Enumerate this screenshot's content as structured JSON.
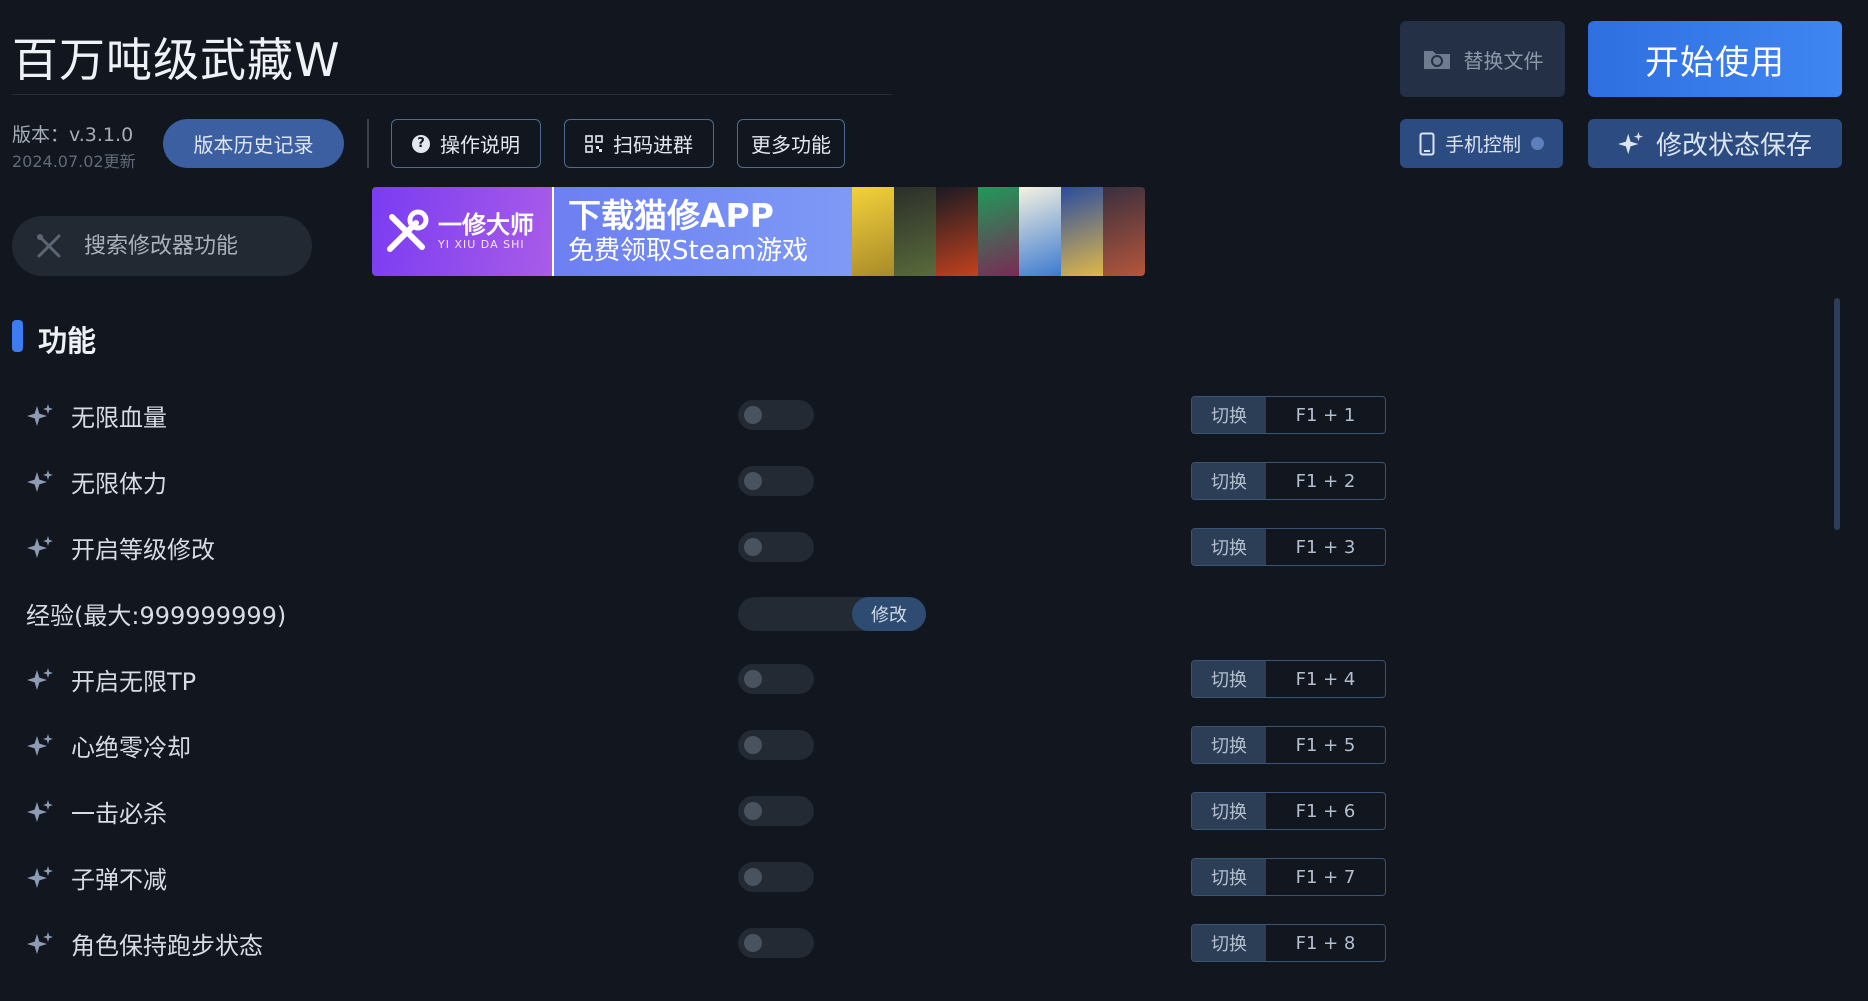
{
  "header": {
    "title": "百万吨级武藏W",
    "version": "版本：v.3.1.0",
    "version_date": "2024.07.02更新",
    "history_button": "版本历史记录",
    "help_button": "操作说明",
    "qr_button": "扫码进群",
    "more_button": "更多功能",
    "replace_file_button": "替换文件",
    "start_button": "开始使用",
    "phone_control_button": "手机控制",
    "save_state_button": "修改状态保存"
  },
  "search": {
    "placeholder": "搜索修改器功能"
  },
  "banner": {
    "brand_name": "一修大师",
    "brand_sub": "YI XIU DA SHI",
    "headline": "下载猫修APP",
    "subline": "免费领取Steam游戏"
  },
  "section": {
    "title": "功能"
  },
  "features": [
    {
      "label": "无限血量",
      "tag": "切换",
      "hotkey": "F1 + 1",
      "enabled": false
    },
    {
      "label": "无限体力",
      "tag": "切换",
      "hotkey": "F1 + 2",
      "enabled": false
    },
    {
      "label": "开启等级修改",
      "tag": "切换",
      "hotkey": "F1 + 3",
      "enabled": false
    },
    {
      "label": "经验(最大:999999999)",
      "input_value": "",
      "modify_button": "修改"
    },
    {
      "label": "开启无限TP",
      "tag": "切换",
      "hotkey": "F1 + 4",
      "enabled": false
    },
    {
      "label": "心绝零冷却",
      "tag": "切换",
      "hotkey": "F1 + 5",
      "enabled": false
    },
    {
      "label": "一击必杀",
      "tag": "切换",
      "hotkey": "F1 + 6",
      "enabled": false
    },
    {
      "label": "子弹不减",
      "tag": "切换",
      "hotkey": "F1 + 7",
      "enabled": false
    },
    {
      "label": "角色保持跑步状态",
      "tag": "切换",
      "hotkey": "F1 + 8",
      "enabled": false
    }
  ],
  "colors": {
    "background": "#11161f",
    "accent": "#3d7cf0",
    "start_button": "#2f6fe0",
    "banner_purple": "#7a3cf2"
  },
  "icons": [
    "search-tools-icon",
    "question-icon",
    "qr-code-icon",
    "folder-swap-icon",
    "phone-icon",
    "sparkle-icon",
    "wrench-logo-icon"
  ]
}
